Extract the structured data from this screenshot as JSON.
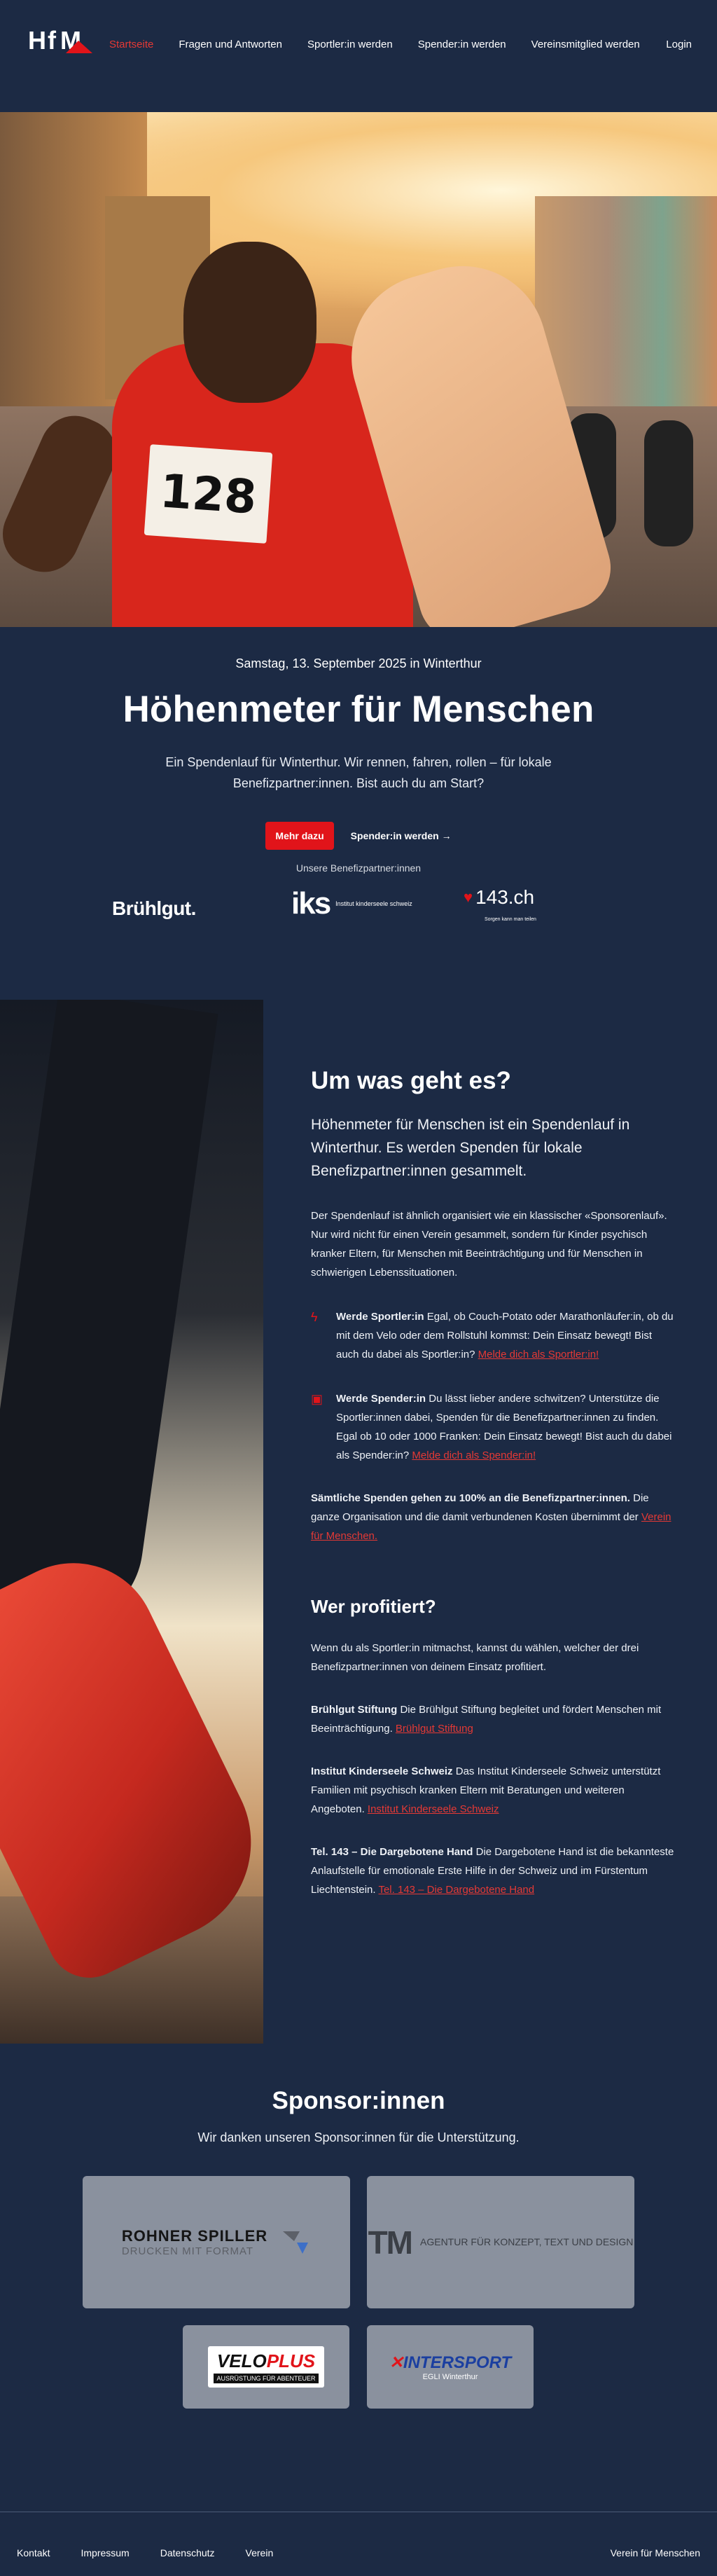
{
  "nav": {
    "logo_text": "HfM",
    "items": [
      {
        "label": "Startseite"
      },
      {
        "label": "Fragen und Antworten"
      },
      {
        "label": "Sportler:in werden"
      },
      {
        "label": "Spender:in werden"
      },
      {
        "label": "Vereinsmitglied werden"
      }
    ],
    "login": "Login"
  },
  "hero": {
    "bib_number": "128",
    "date": "Samstag, 13. September 2025 in Winterthur",
    "title": "Höhenmeter für Menschen",
    "description": "Ein Spendenlauf für Winterthur. Wir rennen, fahren, rollen – für lokale Benefizpartner:innen. Bist auch du am Start?",
    "btn_more": "Mehr dazu",
    "btn_athlete": "Spender:in werden →",
    "partners_label": "Unsere Benefizpartner:innen",
    "partners": {
      "bruehlgut": "Brühlgut.",
      "iks_mark": "iks",
      "iks_text": "Institut kinderseele schweiz",
      "p143": "143.ch",
      "p143_sub": "Sorgen kann man teilen"
    }
  },
  "about": {
    "title": "Um was geht es?",
    "lead": "Höhenmeter für Menschen ist ein Spendenlauf in Winterthur. Es werden Spenden für lokale Benefizpartner:innen gesammelt.",
    "intro": "Der Spendenlauf ist ähnlich organisiert wie ein klassischer «Sponsorenlauf». Nur wird nicht für einen Verein gesammelt, sondern für Kinder psychisch kranker Eltern, für Menschen mit Beeinträchtigung und für Menschen in schwierigen Lebenssituationen.",
    "feature1_bold": "Werde Sportler:in",
    "feature1_text": " Egal, ob Couch-Potato oder Marathonläufer:in, ob du mit dem Velo oder dem Rollstuhl kommst: Dein Einsatz bewegt! Bist auch du dabei als Sportler:in? ",
    "feature1_link": "Melde dich als Sportler:in!",
    "feature2_bold": "Werde Spender:in",
    "feature2_text": " Du lässt lieber andere schwitzen? Unterstütze die Sportler:innen dabei, Spenden für die Benefizpartner:innen zu finden. Egal ob 10 oder 1000 Franken: Dein Einsatz bewegt! Bist auch du dabei als Spender:in? ",
    "feature2_link": "Melde dich als Spender:in!",
    "donation_bold": "Sämtliche Spenden gehen zu 100% an die Benefizpartner:innen.",
    "donation_text": " Die ganze Organisation und die damit verbundenen Kosten übernimmt der ",
    "donation_link": "Verein für Menschen.",
    "who_title": "Wer profitiert?",
    "who_intro": "Wenn du als Sportler:in mitmachst, kannst du wählen, welcher der drei Benefizpartner:innen von deinem Einsatz profitiert.",
    "b1_bold": "Brühlgut Stiftung",
    "b1_text": " Die Brühlgut Stiftung begleitet und fördert Menschen mit Beeinträchtigung. ",
    "b1_link": "Brühlgut Stiftung",
    "b2_bold": "Institut Kinderseele Schweiz",
    "b2_text": " Das Institut Kinderseele Schweiz unterstützt Familien mit psychisch kranken Eltern mit Beratungen und weiteren Angeboten. ",
    "b2_link": "Institut Kinderseele Schweiz",
    "b3_bold": "Tel. 143 – Die Dargebotene Hand",
    "b3_text": " Die Dargebotene Hand ist die bekannteste Anlaufstelle für emotionale Erste Hilfe in der Schweiz und im Fürstentum Liechtenstein. ",
    "b3_link": "Tel. 143 – Die Dargebotene Hand"
  },
  "sponsors": {
    "title": "Sponsor:innen",
    "subtitle": "Wir danken unseren Sponsor:innen für die Unterstützung.",
    "rohner_1": "ROHNER SPILLER",
    "rohner_2": "DRUCKEN MIT FORMAT",
    "tm_big": "TM",
    "tm_small": "AGENTUR FÜR KONZEPT, TEXT UND DESIGN",
    "velo_1": "VELO",
    "velo_2": "PLUS",
    "velo_3": "AUSRÜSTUNG FÜR ABENTEUER",
    "inter_1": "INTERSPORT",
    "inter_2": "EGLI Winterthur"
  },
  "footer": {
    "links": [
      "Kontakt",
      "Impressum",
      "Datenschutz",
      "Verein"
    ],
    "right": "Verein für Menschen"
  }
}
